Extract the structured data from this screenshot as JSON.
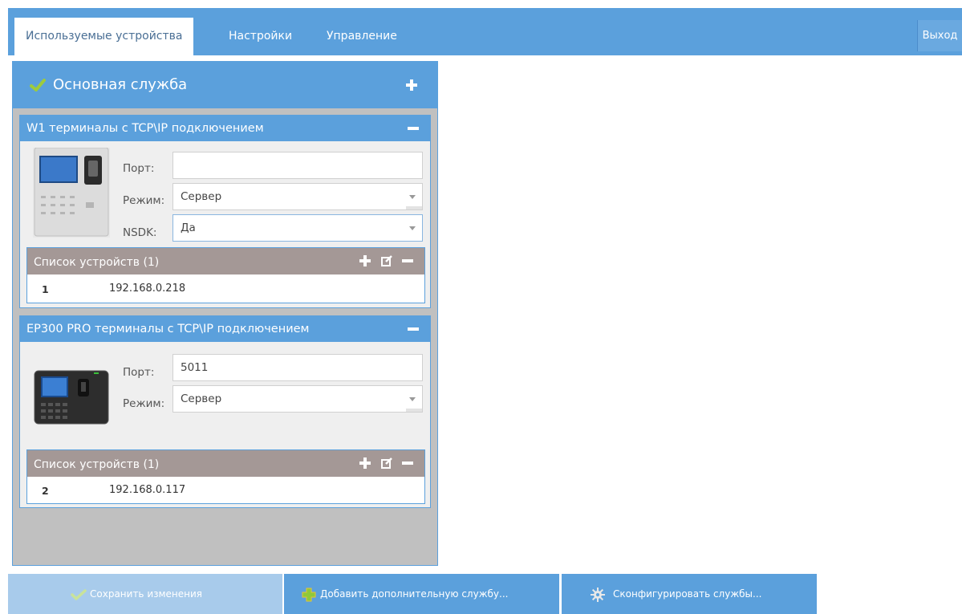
{
  "tabs": [
    "Используемые устройства",
    "Настройки",
    "Управление"
  ],
  "exit_label": "Выход",
  "service": {
    "title": "Основная служба",
    "devices": [
      {
        "title": "W1 терминалы с TCP\\IP подключением",
        "port_label": "Порт:",
        "port_value": "",
        "mode_label": "Режим:",
        "mode_value": "Сервер",
        "nsdk_label": "NSDK:",
        "nsdk_value": "Да",
        "list_title": "Список устройств (1)",
        "rows": [
          {
            "num": "1",
            "ip": "192.168.0.218"
          }
        ]
      },
      {
        "title": "EP300 PRO терминалы с TCP\\IP подключением",
        "port_label": "Порт:",
        "port_value": "5011",
        "mode_label": "Режим:",
        "mode_value": "Сервер",
        "list_title": "Список устройств (1)",
        "rows": [
          {
            "num": "2",
            "ip": "192.168.0.117"
          }
        ]
      }
    ]
  },
  "buttons": {
    "save": "Сохранить изменения",
    "add": "Добавить дополнительную службу...",
    "configure": "Сконфигурировать службы..."
  },
  "colors": {
    "primary": "#5ba0dc",
    "list_header": "#a49896",
    "service_bg": "#c0c0c0",
    "save_button_disabled": "#a8cbeb",
    "check_green": "#9ecb3c"
  },
  "icons": [
    "check-icon",
    "plus-icon",
    "minus-icon",
    "edit-icon",
    "gear-icon",
    "add-plus-icon",
    "chevron-down-icon",
    "terminal-device-image"
  ]
}
